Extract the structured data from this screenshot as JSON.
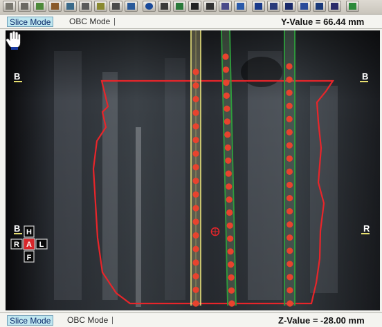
{
  "top_bar": {
    "tab_active": "Slice Mode",
    "tab_inactive": "OBC Mode",
    "readout": "Y-Value = 66.44 mm"
  },
  "bottom_bar": {
    "tab_active": "Slice Mode",
    "tab_inactive": "OBC Mode",
    "readout": "Z-Value = -28.00 mm"
  },
  "viewport": {
    "left_labels": [
      "B",
      "B"
    ],
    "right_labels": [
      "B",
      "R"
    ],
    "orientation": {
      "top": "H",
      "left": "R",
      "center": "A",
      "right": "L",
      "bottom": "F"
    }
  },
  "colors": {
    "contour": "#e8252a",
    "needle_yellow": "#e6e07a",
    "needle_green": "#2e9e3c",
    "seed": "#e8432e",
    "active_tab_bg": "#bfe6ef"
  },
  "icons": [
    "toolbar-tool-icons",
    "hand-cursor-icon",
    "orientation-cross-icon"
  ]
}
